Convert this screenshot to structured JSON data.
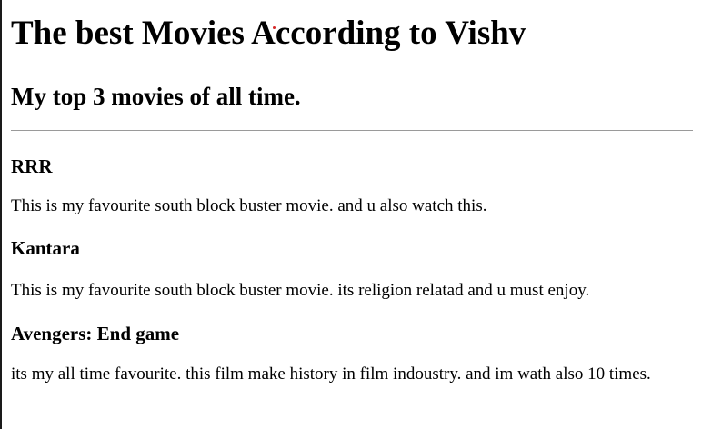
{
  "page": {
    "title": "The best Movies According to Vishv",
    "subtitle": "My top 3 movies of all time."
  },
  "movies": [
    {
      "title": "RRR",
      "description": "This is my favourite south block buster movie. and u also watch this."
    },
    {
      "title": "Kantara",
      "description": "This is my favourite south block buster movie. its religion relatad and u must enjoy."
    },
    {
      "title": "Avengers: End game",
      "description": "its my all time favourite. this film make history in film indoustry. and im wath also 10 times."
    }
  ]
}
